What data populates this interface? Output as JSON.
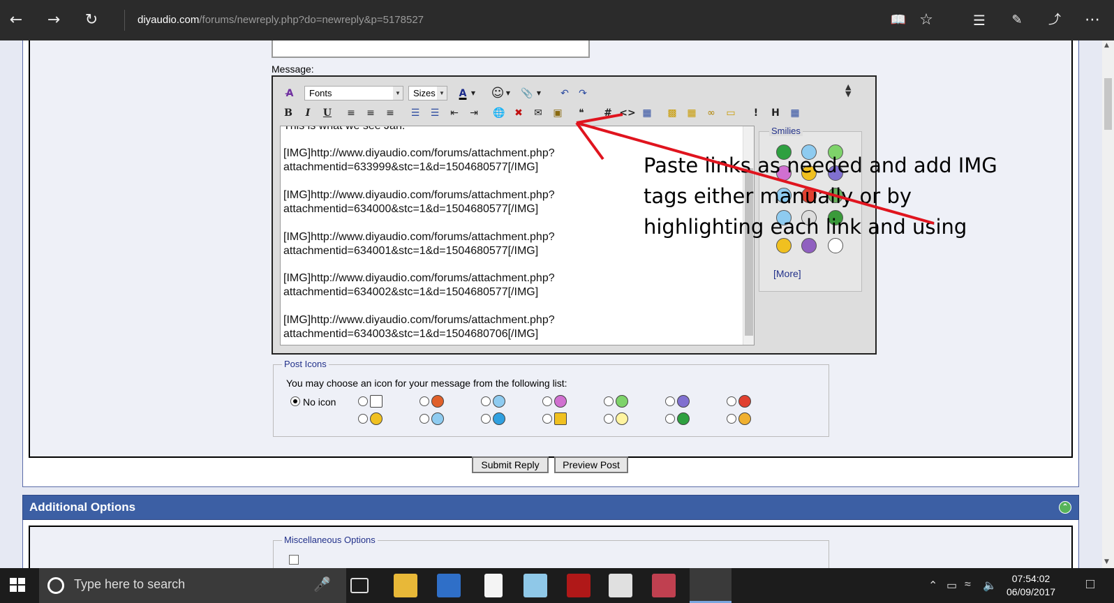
{
  "browser": {
    "url_domain": "diyaudio.com",
    "url_path": "/forums/newreply.php?do=newreply&p=5178527",
    "nav": [
      "back",
      "forward",
      "refresh"
    ],
    "actions": [
      "reading-view",
      "favorites",
      "hub",
      "web-note",
      "share",
      "more"
    ]
  },
  "form": {
    "message_label": "Message:",
    "editor": {
      "font_select": "Fonts",
      "size_select": "Sizes",
      "lines": [
        "This is what we see Jan.",
        "",
        "[IMG]http://www.diyaudio.com/forums/attachment.php?",
        "attachmentid=633999&stc=1&d=1504680577[/IMG]",
        "",
        "[IMG]http://www.diyaudio.com/forums/attachment.php?",
        "attachmentid=634000&stc=1&d=1504680577[/IMG]",
        "",
        "[IMG]http://www.diyaudio.com/forums/attachment.php?",
        "attachmentid=634001&stc=1&d=1504680577[/IMG]",
        "",
        "[IMG]http://www.diyaudio.com/forums/attachment.php?",
        "attachmentid=634002&stc=1&d=1504680577[/IMG]",
        "",
        "[IMG]http://www.diyaudio.com/forums/attachment.php?",
        "attachmentid=634003&stc=1&d=1504680706[/IMG]"
      ]
    },
    "smilies": {
      "legend": "Smilies",
      "more": "[More]"
    },
    "annotation": "Paste links as needed and add IMG tags either manually or by highlighting each link and using",
    "post_icons": {
      "legend": "Post Icons",
      "description": "You may choose an icon for your message from the following list:",
      "no_icon_label": "No icon",
      "selected": "No icon"
    },
    "buttons": {
      "submit": "Submit Reply",
      "preview": "Preview Post"
    }
  },
  "additional_options": {
    "title": "Additional Options",
    "misc_legend": "Miscellaneous Options"
  },
  "taskbar": {
    "search_placeholder": "Type here to search",
    "time": "07:54:02",
    "date": "06/09/2017"
  },
  "colors": {
    "header_blue": "#3c5fa4",
    "link_blue": "#22318a",
    "arrow_red": "#e0141e",
    "taskbar": "#1c1c1c"
  }
}
